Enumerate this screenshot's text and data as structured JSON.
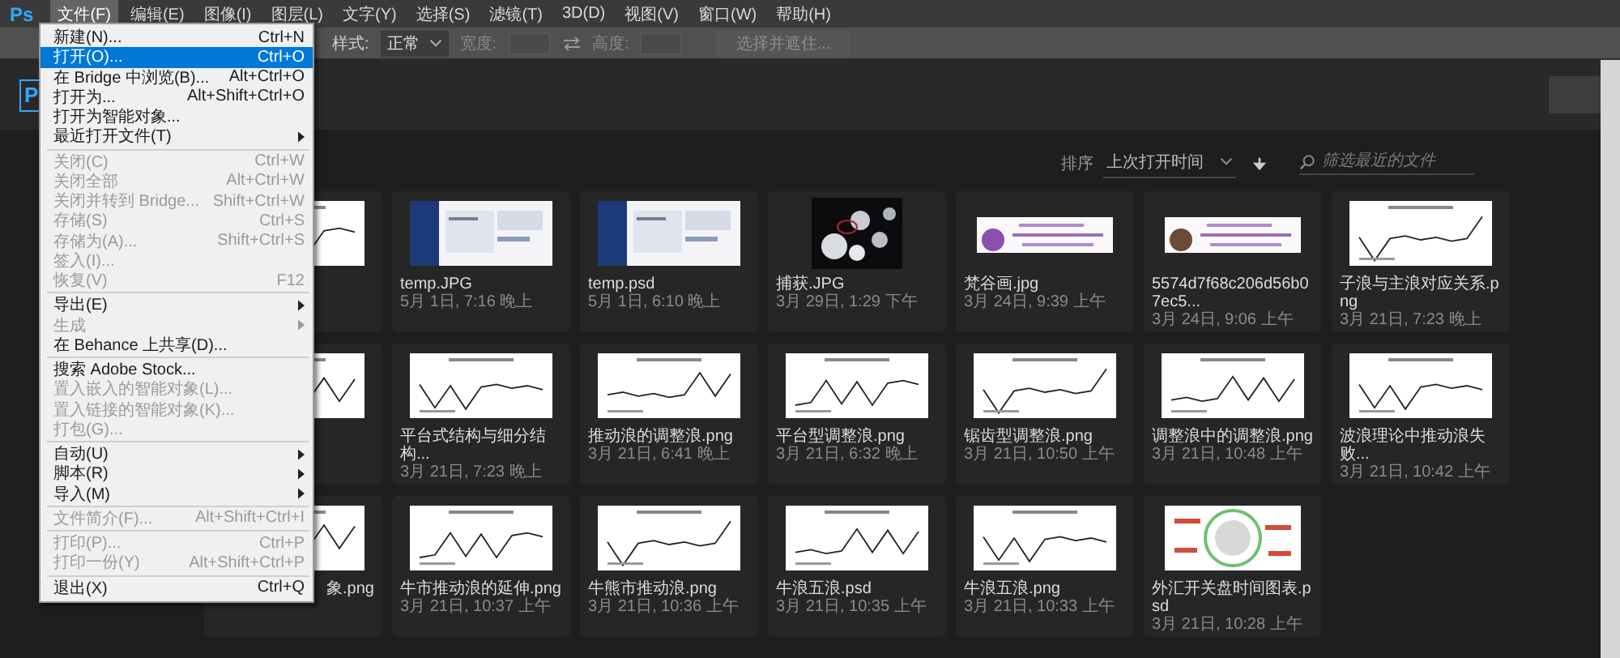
{
  "menubar": {
    "logo": "Ps",
    "items": [
      {
        "label": "文件(F)",
        "selected": true
      },
      {
        "label": "编辑(E)",
        "selected": false
      },
      {
        "label": "图像(I)",
        "selected": false
      },
      {
        "label": "图层(L)",
        "selected": false
      },
      {
        "label": "文字(Y)",
        "selected": false
      },
      {
        "label": "选择(S)",
        "selected": false
      },
      {
        "label": "滤镜(T)",
        "selected": false
      },
      {
        "label": "3D(D)",
        "selected": false
      },
      {
        "label": "视图(V)",
        "selected": false
      },
      {
        "label": "窗口(W)",
        "selected": false
      },
      {
        "label": "帮助(H)",
        "selected": false
      }
    ]
  },
  "options_bar": {
    "style_label": "样式:",
    "style_value": "正常",
    "width_label": "宽度:",
    "width_disabled": true,
    "height_label": "高度:",
    "height_disabled": true,
    "mask_button": "选择并遮住...",
    "mask_disabled": true
  },
  "home": {
    "logo": "P",
    "sort_label": "排序",
    "sort_value": "上次打开时间",
    "search_placeholder": "筛选最近的文件",
    "recent_files": [
      {
        "kind": "partial"
      },
      {
        "kind": "file",
        "name": "temp.JPG",
        "date": "5月 1日, 7:16 晚上"
      },
      {
        "kind": "file",
        "name": "temp.psd",
        "date": "5月 1日, 6:10 晚上"
      },
      {
        "kind": "file",
        "name": "捕获.JPG",
        "date": "3月 29日, 1:29 下午"
      },
      {
        "kind": "file",
        "name": "梵谷画.jpg",
        "date": "3月 24日, 9:39 上午"
      },
      {
        "kind": "file",
        "name": "5574d7f68c206d56b07ec5...",
        "date": "3月 24日, 9:06 上午"
      },
      {
        "kind": "file",
        "name": "子浪与主浪对应关系.png",
        "date": "3月 21日, 7:23 晚上"
      },
      {
        "kind": "partial"
      },
      {
        "kind": "file",
        "name": "平台式结构与细分结构...",
        "date": "3月 21日, 7:23 晚上"
      },
      {
        "kind": "file",
        "name": "推动浪的调整浪.png",
        "date": "3月 21日, 6:41 晚上"
      },
      {
        "kind": "file",
        "name": "平台型调整浪.png",
        "date": "3月 21日, 6:32 晚上"
      },
      {
        "kind": "file",
        "name": "锯齿型调整浪.png",
        "date": "3月 21日, 10:50 上午"
      },
      {
        "kind": "file",
        "name": "调整浪中的调整浪.png",
        "date": "3月 21日, 10:48 上午"
      },
      {
        "kind": "file",
        "name": "波浪理论中推动浪失败...",
        "date": "3月 21日, 10:42 上午"
      },
      {
        "kind": "partial",
        "name": "象.png"
      },
      {
        "kind": "file",
        "name": "牛市推动浪的延伸.png",
        "date": "3月 21日, 10:37 上午"
      },
      {
        "kind": "file",
        "name": "牛熊市推动浪.png",
        "date": "3月 21日, 10:36 上午"
      },
      {
        "kind": "file",
        "name": "牛浪五浪.psd",
        "date": "3月 21日, 10:35 上午"
      },
      {
        "kind": "file",
        "name": "牛浪五浪.png",
        "date": "3月 21日, 10:33 上午"
      },
      {
        "kind": "file",
        "name": "外汇开关盘时间图表.psd",
        "date": "3月 21日, 10:28 上午"
      }
    ]
  },
  "file_menu": {
    "items": [
      {
        "kind": "item",
        "label": "新建(N)...",
        "shortcut": "Ctrl+N",
        "selected": false,
        "disabled": false
      },
      {
        "kind": "item",
        "label": "打开(O)...",
        "shortcut": "Ctrl+O",
        "selected": true,
        "disabled": false
      },
      {
        "kind": "item",
        "label": "在 Bridge 中浏览(B)...",
        "shortcut": "Alt+Ctrl+O",
        "selected": false,
        "disabled": false
      },
      {
        "kind": "item",
        "label": "打开为...",
        "shortcut": "Alt+Shift+Ctrl+O",
        "selected": false,
        "disabled": false
      },
      {
        "kind": "item",
        "label": "打开为智能对象...",
        "selected": false,
        "disabled": false
      },
      {
        "kind": "submenu",
        "label": "最近打开文件(T)",
        "selected": false,
        "disabled": false
      },
      {
        "kind": "separator"
      },
      {
        "kind": "item",
        "label": "关闭(C)",
        "shortcut": "Ctrl+W",
        "selected": false,
        "disabled": true
      },
      {
        "kind": "item",
        "label": "关闭全部",
        "shortcut": "Alt+Ctrl+W",
        "selected": false,
        "disabled": true
      },
      {
        "kind": "item",
        "label": "关闭并转到 Bridge...",
        "shortcut": "Shift+Ctrl+W",
        "selected": false,
        "disabled": true
      },
      {
        "kind": "item",
        "label": "存储(S)",
        "shortcut": "Ctrl+S",
        "selected": false,
        "disabled": true
      },
      {
        "kind": "item",
        "label": "存储为(A)...",
        "shortcut": "Shift+Ctrl+S",
        "selected": false,
        "disabled": true
      },
      {
        "kind": "item",
        "label": "签入(I)...",
        "selected": false,
        "disabled": true
      },
      {
        "kind": "item",
        "label": "恢复(V)",
        "shortcut": "F12",
        "selected": false,
        "disabled": true
      },
      {
        "kind": "separator"
      },
      {
        "kind": "submenu",
        "label": "导出(E)",
        "selected": false,
        "disabled": false
      },
      {
        "kind": "submenu",
        "label": "生成",
        "selected": false,
        "disabled": true
      },
      {
        "kind": "item",
        "label": "在 Behance 上共享(D)...",
        "selected": false,
        "disabled": false
      },
      {
        "kind": "separator"
      },
      {
        "kind": "item",
        "label": "搜索 Adobe Stock...",
        "selected": false,
        "disabled": false
      },
      {
        "kind": "item",
        "label": "置入嵌入的智能对象(L)...",
        "selected": false,
        "disabled": true
      },
      {
        "kind": "item",
        "label": "置入链接的智能对象(K)...",
        "selected": false,
        "disabled": true
      },
      {
        "kind": "item",
        "label": "打包(G)...",
        "selected": false,
        "disabled": true
      },
      {
        "kind": "separator"
      },
      {
        "kind": "submenu",
        "label": "自动(U)",
        "selected": false,
        "disabled": false
      },
      {
        "kind": "submenu",
        "label": "脚本(R)",
        "selected": false,
        "disabled": false
      },
      {
        "kind": "submenu",
        "label": "导入(M)",
        "selected": false,
        "disabled": false
      },
      {
        "kind": "separator"
      },
      {
        "kind": "item",
        "label": "文件简介(F)...",
        "shortcut": "Alt+Shift+Ctrl+I",
        "selected": false,
        "disabled": true
      },
      {
        "kind": "separator"
      },
      {
        "kind": "item",
        "label": "打印(P)...",
        "shortcut": "Ctrl+P",
        "selected": false,
        "disabled": true
      },
      {
        "kind": "item",
        "label": "打印一份(Y)",
        "shortcut": "Alt+Shift+Ctrl+P",
        "selected": false,
        "disabled": true
      },
      {
        "kind": "separator"
      },
      {
        "kind": "item",
        "label": "退出(X)",
        "shortcut": "Ctrl+Q",
        "selected": false,
        "disabled": false
      }
    ]
  }
}
